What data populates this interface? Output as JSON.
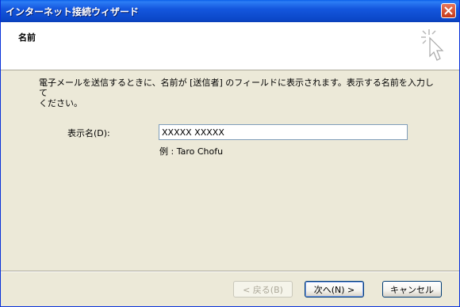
{
  "window": {
    "title": "インターネット接続ウィザード"
  },
  "header": {
    "title": "名前"
  },
  "description": {
    "line1": "電子メールを送信するときに、名前が [送信者] のフィールドに表示されます。表示する名前を入力して",
    "line2": "ください。"
  },
  "form": {
    "display_name_label": "表示名",
    "display_name_shortcut": "(D):",
    "display_name_value": "XXXXX XXXXX",
    "example": "例 : Taro Chofu"
  },
  "buttons": {
    "back": "< 戻る(B)",
    "next": "次へ(N) >",
    "cancel": "キャンセル"
  },
  "colors": {
    "titlebar": "#0b47c8",
    "dialog_bg": "#ece9d8",
    "close_button": "#c4391a"
  },
  "icons": {
    "close": "close-icon",
    "wizard": "wizard-wand-icon"
  }
}
